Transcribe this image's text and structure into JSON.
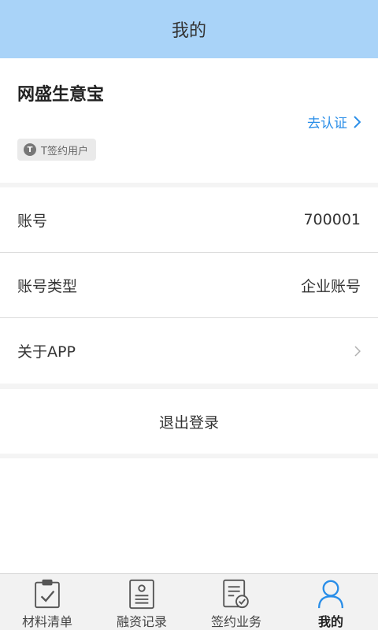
{
  "header": {
    "title": "我的"
  },
  "profile": {
    "company_name": "网盛生意宝",
    "verify_label": "去认证",
    "tag_icon_letter": "T",
    "tag_label": "T签约用户"
  },
  "rows": [
    {
      "label": "账号",
      "value": "700001"
    },
    {
      "label": "账号类型",
      "value": "企业账号"
    },
    {
      "label": "关于APP",
      "value": ""
    }
  ],
  "logout_label": "退出登录",
  "tabbar": {
    "tabs": [
      {
        "label": "材料清单",
        "icon": "checklist-icon"
      },
      {
        "label": "融资记录",
        "icon": "record-icon"
      },
      {
        "label": "签约业务",
        "icon": "contract-icon"
      },
      {
        "label": "我的",
        "icon": "user-icon",
        "active": true
      }
    ]
  },
  "colors": {
    "header_bg": "#a9d3f8",
    "link": "#2a8ee8",
    "active_tab": "#2a8ee8"
  }
}
